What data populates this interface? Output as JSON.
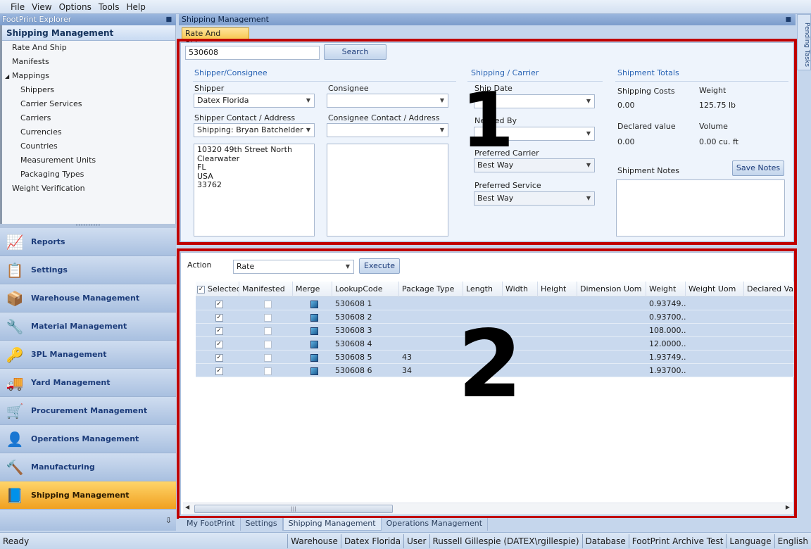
{
  "menu": [
    "File",
    "View",
    "Options",
    "Tools",
    "Help"
  ],
  "explorer": {
    "title": "FootPrint Explorer",
    "tree_header": "Shipping Management",
    "tree_items": [
      {
        "label": "Rate And Ship",
        "indent": 1
      },
      {
        "label": "Manifests",
        "indent": 1
      },
      {
        "label": "Mappings",
        "indent": 1,
        "expanded": true
      },
      {
        "label": "Shippers",
        "indent": 2
      },
      {
        "label": "Carrier Services",
        "indent": 2
      },
      {
        "label": "Carriers",
        "indent": 2
      },
      {
        "label": "Currencies",
        "indent": 2
      },
      {
        "label": "Countries",
        "indent": 2
      },
      {
        "label": "Measurement Units",
        "indent": 2
      },
      {
        "label": "Packaging Types",
        "indent": 2
      },
      {
        "label": "Weight Verification",
        "indent": 1
      }
    ]
  },
  "nav": [
    {
      "label": "Reports",
      "icon": "reports-icon",
      "glyph": "📈"
    },
    {
      "label": "Settings",
      "icon": "settings-icon",
      "glyph": "📋"
    },
    {
      "label": "Warehouse Management",
      "icon": "warehouse-icon",
      "glyph": "📦"
    },
    {
      "label": "Material Management",
      "icon": "material-icon",
      "glyph": "🔧"
    },
    {
      "label": "3PL Management",
      "icon": "3pl-icon",
      "glyph": "🔑"
    },
    {
      "label": "Yard Management",
      "icon": "yard-icon",
      "glyph": "🚚"
    },
    {
      "label": "Procurement Management",
      "icon": "procurement-icon",
      "glyph": "🛒"
    },
    {
      "label": "Operations Management",
      "icon": "operations-icon",
      "glyph": "👤"
    },
    {
      "label": "Manufacturing",
      "icon": "manufacturing-icon",
      "glyph": "🔨"
    },
    {
      "label": "Shipping Management",
      "icon": "shipping-icon",
      "glyph": "📘",
      "active": true
    }
  ],
  "main_title": "Shipping Management",
  "pending_tasks": "Pending Tasks",
  "doc_tab": "Rate And Ship",
  "search": {
    "value": "530608",
    "button": "Search"
  },
  "shipper_consignee": {
    "section": "Shipper/Consignee",
    "shipper_label": "Shipper",
    "shipper_value": "Datex Florida",
    "consignee_label": "Consignee",
    "consignee_value": "",
    "shipper_contact_label": "Shipper Contact / Address",
    "shipper_contact_value": "Shipping: Bryan Batchelder",
    "consignee_contact_label": "Consignee Contact / Address",
    "consignee_contact_value": "",
    "shipper_address": "10320 49th Street North\nClearwater\nFL\nUSA\n33762",
    "consignee_address": ""
  },
  "shipping_carrier": {
    "section": "Shipping / Carrier",
    "ship_date_label": "Ship Date",
    "ship_date_value": "",
    "needed_by_label": "Needed By",
    "needed_by_value": "",
    "preferred_carrier_label": "Preferred Carrier",
    "preferred_carrier_value": "Best Way",
    "preferred_service_label": "Preferred Service",
    "preferred_service_value": "Best Way"
  },
  "totals": {
    "section": "Shipment Totals",
    "shipping_costs_label": "Shipping Costs",
    "shipping_costs_value": "0.00",
    "weight_label": "Weight",
    "weight_value": "125.75 lb",
    "declared_label": "Declared value",
    "declared_value": "0.00",
    "volume_label": "Volume",
    "volume_value": "0.00 cu. ft",
    "notes_label": "Shipment Notes",
    "save_notes": "Save Notes"
  },
  "action": {
    "label": "Action",
    "value": "Rate",
    "execute": "Execute"
  },
  "grid": {
    "columns": [
      "Selected",
      "Manifested",
      "Merge",
      "LookupCode",
      "Package Type",
      "Length",
      "Width",
      "Height",
      "Dimension Uom",
      "Weight",
      "Weight Uom",
      "Declared Valu"
    ],
    "rows": [
      {
        "selected": true,
        "manifested": false,
        "lookup": "530608 1",
        "package_type": "",
        "weight": "0.93749..."
      },
      {
        "selected": true,
        "manifested": false,
        "lookup": "530608 2",
        "package_type": "",
        "weight": "0.93700..."
      },
      {
        "selected": true,
        "manifested": false,
        "lookup": "530608 3",
        "package_type": "",
        "weight": "108.000..."
      },
      {
        "selected": true,
        "manifested": false,
        "lookup": "530608 4",
        "package_type": "",
        "weight": "12.0000..."
      },
      {
        "selected": true,
        "manifested": false,
        "lookup": "530608 5",
        "package_type": "43",
        "weight": "1.93749..."
      },
      {
        "selected": true,
        "manifested": false,
        "lookup": "530608 6",
        "package_type": "34",
        "weight": "1.93700..."
      }
    ]
  },
  "annotations": {
    "box1": "1",
    "box2": "2"
  },
  "bottom_tabs": [
    {
      "label": "My FootPrint"
    },
    {
      "label": "Settings"
    },
    {
      "label": "Shipping Management",
      "active": true
    },
    {
      "label": "Operations Management"
    }
  ],
  "status": {
    "ready": "Ready",
    "warehouse_label": "Warehouse",
    "warehouse_value": "Datex Florida",
    "user_label": "User",
    "user_value": "Russell Gillespie (DATEX\\rgillespie)",
    "database_label": "Database",
    "database_value": "FootPrint Archive Test",
    "language_label": "Language",
    "language_value": "English"
  },
  "colors": {
    "annotation_red": "#c00000",
    "active_nav": "#f0a020",
    "section_blue": "#2a64b4"
  }
}
